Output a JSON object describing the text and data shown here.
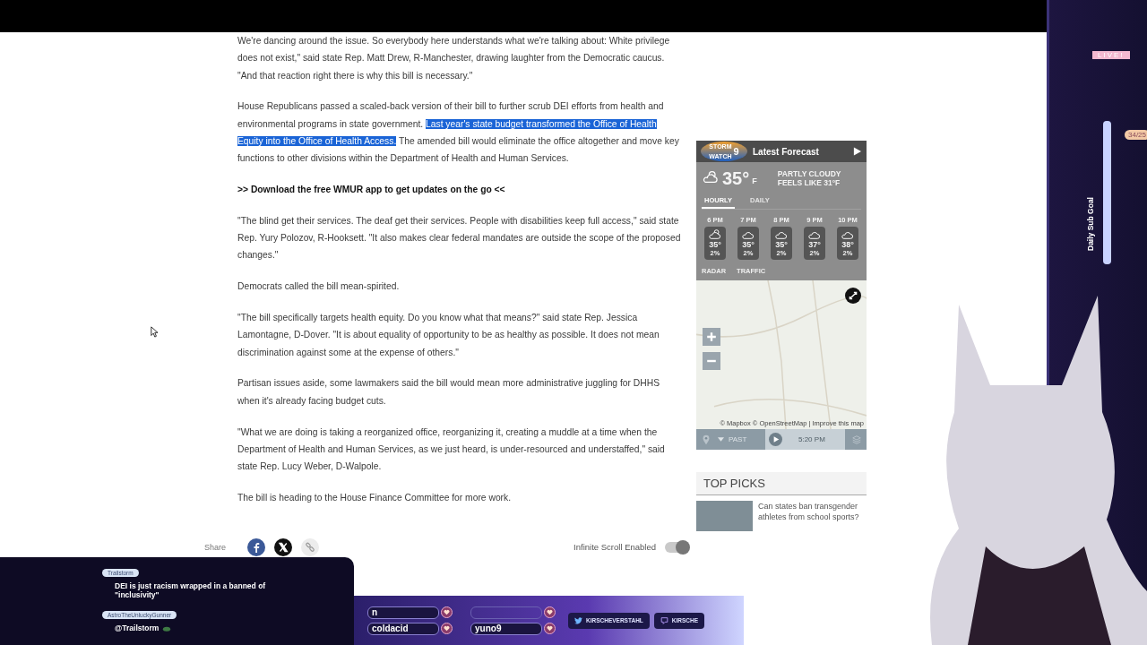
{
  "article": {
    "paragraphs": [
      {
        "kind": "text",
        "parts": [
          {
            "text": "We're dancing around the issue. So everybody here understands what we're talking about: White privilege does not exist,\" said state Rep. Matt Drew, R-Manchester, drawing laughter from the Democratic caucus. \"And that reaction right there is why this bill is necessary.\"",
            "highlighted": false
          }
        ]
      },
      {
        "kind": "text",
        "parts": [
          {
            "text": "House Republicans passed a scaled-back version of their bill to further scrub DEI efforts from health and environmental programs in state government. ",
            "highlighted": false
          },
          {
            "text": "Last year's state budget transformed the Office of Health Equity into the Office of Health Access.",
            "highlighted": true
          },
          {
            "text": " The amended bill would eliminate the office altogether and move key functions to other divisions within the Department of Health and Human Services.",
            "highlighted": false
          }
        ]
      },
      {
        "kind": "promo",
        "parts": [
          {
            "text": ">> Download the free WMUR app to get updates on the go <<",
            "highlighted": false
          }
        ]
      },
      {
        "kind": "text",
        "parts": [
          {
            "text": "\"The blind get their services. The deaf get their services. People with disabilities keep full access,\" said state Rep. Yury Polozov, R-Hooksett. \"It also makes clear federal mandates are outside the scope of the proposed changes.\"",
            "highlighted": false
          }
        ]
      },
      {
        "kind": "text",
        "parts": [
          {
            "text": "Democrats called the bill mean-spirited.",
            "highlighted": false
          }
        ]
      },
      {
        "kind": "text",
        "parts": [
          {
            "text": "\"The bill specifically targets health equity. Do you know what that means?\" said state Rep. Jessica Lamontagne, D-Dover. \"It is about equality of opportunity to be as healthy as possible. It does not mean discrimination against some at the expense of others.\"",
            "highlighted": false
          }
        ]
      },
      {
        "kind": "text",
        "parts": [
          {
            "text": "Partisan issues aside, some lawmakers said the bill would mean more administrative juggling for DHHS when it's already facing budget cuts.",
            "highlighted": false
          }
        ]
      },
      {
        "kind": "text",
        "parts": [
          {
            "text": "\"What we are doing is taking a reorganized office, reorganizing it, creating a muddle at a time when the Department of Health and Human Services, as we just heard, is under-resourced and understaffed,\" said state Rep. Lucy Weber, D-Walpole.",
            "highlighted": false
          }
        ]
      },
      {
        "kind": "text",
        "parts": [
          {
            "text": "The bill is heading to the House Finance Committee for more work.",
            "highlighted": false
          }
        ]
      }
    ]
  },
  "share": {
    "label": "Share"
  },
  "infinite_scroll": {
    "label": "Infinite Scroll Enabled",
    "on": true
  },
  "weather": {
    "logo": {
      "line1": "STORM",
      "line2": "WATCH",
      "number": "9"
    },
    "title": "Latest Forecast",
    "current": {
      "temp": "35°",
      "unit": "F",
      "condition": "PARTLY CLOUDY",
      "feels_like": "FEELS LIKE 31°F"
    },
    "tabs": [
      {
        "label": "HOURLY",
        "selected": true
      },
      {
        "label": "DAILY",
        "selected": false
      }
    ],
    "hourly": [
      {
        "time": "6 PM",
        "kind": "partly-cloudy",
        "temp": "35°",
        "precip": "2%"
      },
      {
        "time": "7 PM",
        "kind": "cloudy",
        "temp": "35°",
        "precip": "2%"
      },
      {
        "time": "8 PM",
        "kind": "cloudy",
        "temp": "35°",
        "precip": "2%"
      },
      {
        "time": "9 PM",
        "kind": "cloudy",
        "temp": "37°",
        "precip": "2%"
      },
      {
        "time": "10 PM",
        "kind": "cloudy",
        "temp": "38°",
        "precip": "2%"
      }
    ],
    "links": [
      "RADAR",
      "TRAFFIC"
    ],
    "map": {
      "attribution": "© Mapbox © OpenStreetMap | Improve this map",
      "mode": "PAST",
      "time": "5:20 PM"
    }
  },
  "top_picks": {
    "title": "TOP PICKS",
    "items": [
      {
        "title": "Can states ban transgender athletes from school sports?"
      }
    ]
  },
  "stream_overlay": {
    "chat": [
      {
        "user": "Trailstorm",
        "message": "DEI is just racism wrapped in a banned of \"inclusivity\"",
        "has_emote": false
      },
      {
        "user": "AstroTheUnluckyGunner",
        "message": "@Trailstorm",
        "has_emote": true
      }
    ],
    "slots": [
      {
        "name": "n",
        "filled": true
      },
      {
        "filled": false
      },
      {
        "name": "coldacid",
        "filled": true
      },
      {
        "name": "yuno9",
        "filled": true
      }
    ],
    "socials": [
      {
        "kind": "twitter",
        "handle": "KIRSCHEVERSTAHL"
      },
      {
        "kind": "twitch",
        "handle": "KIRSCHE"
      }
    ],
    "live_badge": "LIVE!",
    "sub_goal": {
      "label": "Daily Sub Goal",
      "count": "34/25",
      "level": 1
    }
  }
}
